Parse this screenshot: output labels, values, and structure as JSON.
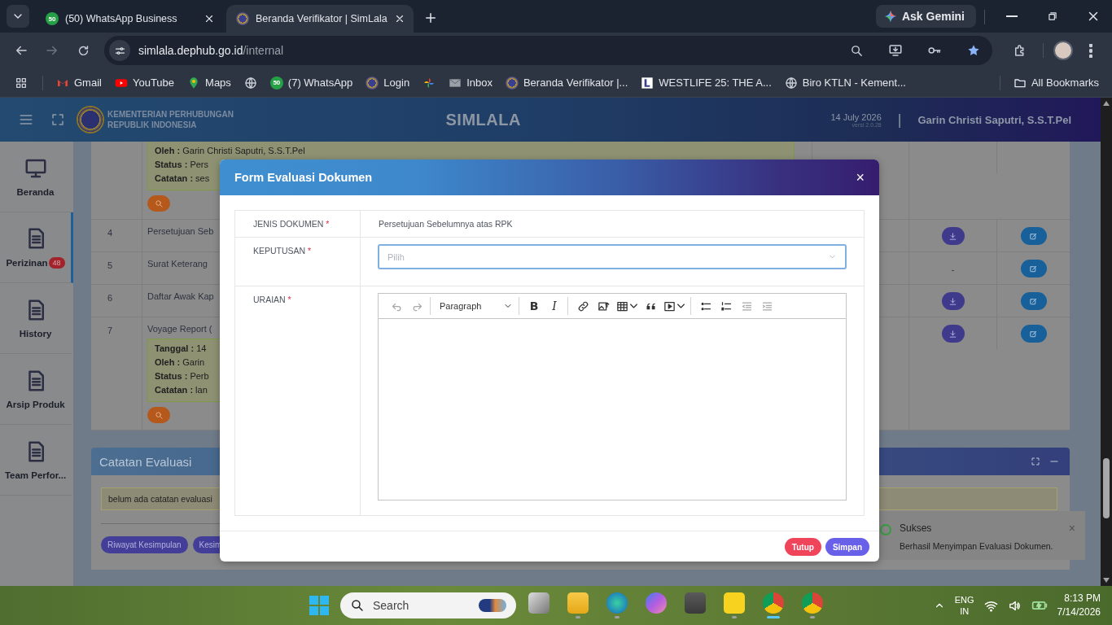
{
  "browser": {
    "tabs": [
      {
        "title": "(50) WhatsApp Business",
        "selected": false,
        "kind": "whatsapp",
        "icon_text": "50"
      },
      {
        "title": "Beranda Verifikator | SimLala",
        "selected": true,
        "kind": "emblem"
      }
    ],
    "ask_gemini": "Ask Gemini",
    "url_host": "simlala.dephub.go.id",
    "url_path": "/internal",
    "bookmarked": true,
    "bookmarks": [
      {
        "kind": "gmail",
        "label": "Gmail"
      },
      {
        "kind": "youtube",
        "label": "YouTube"
      },
      {
        "kind": "maps",
        "label": "Maps"
      },
      {
        "kind": "globe"
      },
      {
        "kind": "whatsapp",
        "icon_text": "50",
        "label": "(7) WhatsApp"
      },
      {
        "kind": "emblem",
        "label": "Login"
      },
      {
        "kind": "pinwheel"
      },
      {
        "kind": "mail",
        "label": "Inbox"
      },
      {
        "kind": "emblem",
        "label": "Beranda Verifikator |..."
      },
      {
        "kind": "letter-tile",
        "label": "WESTLIFE 25: THE A..."
      },
      {
        "kind": "globe",
        "label": "Biro KTLN - Kement..."
      }
    ],
    "all_bookmarks": "All Bookmarks"
  },
  "header": {
    "org_line1": "KEMENTERIAN PERHUBUNGAN",
    "org_line2": "REPUBLIK INDONESIA",
    "app_name": "SIMLALA",
    "date": "14 July 2026",
    "version": "versi 2.0.28",
    "separator": "|",
    "user": "Garin Christi Saputri, S.S.T.Pel"
  },
  "sidebar": {
    "items": [
      {
        "kind": "monitor",
        "label": "Beranda",
        "selected": false
      },
      {
        "kind": "document",
        "label": "Perizinan",
        "badge": "48",
        "selected": true
      },
      {
        "kind": "document",
        "label": "History",
        "selected": false
      },
      {
        "kind": "document",
        "label": "Arsip Produk",
        "selected": false
      },
      {
        "kind": "document",
        "label": "Team Perfor..."
      }
    ]
  },
  "documents": {
    "rows": [
      {
        "note": [
          "**Oleh :** Garin Christi Saputri, S.S.T.Pel",
          "**Status :** Pers",
          "**Catatan :** ses"
        ]
      },
      {
        "no": "4",
        "name": "Persetujuan Seb",
        "download": {
          "kind": "button"
        }
      },
      {
        "no": "5",
        "name": "Surat Keterang",
        "download": {
          "kind": "text",
          "text": "-"
        }
      },
      {
        "no": "6",
        "name": "Daftar Awak Kap",
        "download": {
          "kind": "button"
        }
      },
      {
        "no": "7",
        "name": "Voyage Report (",
        "download": {
          "kind": "button"
        },
        "note": [
          "**Tanggal :** 14",
          "**Oleh :** Garin",
          "**Status :** Perb",
          "**Catatan :** lan"
        ]
      }
    ]
  },
  "evaluation_notes": {
    "title": "Catatan Evaluasi",
    "note": "belum ada catatan evaluasi",
    "buttons": [
      "Riwayat Kesimpulan",
      "Kesim"
    ]
  },
  "toast": {
    "title": "Sukses",
    "message": "Berhasil Menyimpan Evaluasi Dokumen.",
    "close": "×"
  },
  "modal": {
    "title": "Form Evaluasi Dokumen",
    "close": "×",
    "fields": [
      {
        "kind": "static",
        "label": "JENIS DOKUMEN",
        "required_mark": "*",
        "value": "Persetujuan Sebelumnya atas RPK"
      },
      {
        "kind": "select",
        "label": "KEPUTUSAN",
        "required_mark": "*",
        "placeholder": "Pilih",
        "focused": true
      },
      {
        "kind": "editor",
        "label": "URAIAN",
        "required_mark": "*",
        "toolbar": [
          [
            {
              "kind": "undo",
              "disabled": true
            },
            {
              "kind": "redo",
              "disabled": true
            }
          ],
          [
            {
              "kind": "heading",
              "label": "Paragraph",
              "disabled": false
            }
          ],
          [
            {
              "kind": "bold",
              "glyph": "B",
              "disabled": false
            },
            {
              "kind": "italic",
              "glyph": "I",
              "disabled": false
            }
          ],
          [
            {
              "kind": "link",
              "disabled": false
            },
            {
              "kind": "image",
              "disabled": false
            },
            {
              "kind": "table",
              "dropdown": true,
              "disabled": false
            },
            {
              "kind": "quote",
              "disabled": false
            },
            {
              "kind": "media",
              "dropdown": true,
              "disabled": false
            }
          ],
          [
            {
              "kind": "bulleted-list",
              "disabled": false
            },
            {
              "kind": "numbered-list",
              "disabled": false
            },
            {
              "kind": "outdent",
              "disabled": true
            },
            {
              "kind": "indent",
              "disabled": true
            }
          ]
        ]
      }
    ],
    "buttons": [
      {
        "kind": "danger",
        "label": "Tutup"
      },
      {
        "kind": "primary",
        "label": "Simpan"
      }
    ]
  },
  "taskbar": {
    "search_placeholder": "Search",
    "apps": [
      {
        "kind": "task-view",
        "running": false,
        "active": false
      },
      {
        "kind": "folder",
        "running": true,
        "active": false
      },
      {
        "kind": "edge",
        "running": true,
        "active": false
      },
      {
        "kind": "copilot",
        "running": false,
        "active": false
      },
      {
        "kind": "camera",
        "running": false,
        "active": false
      },
      {
        "kind": "sticky-notes",
        "running": true,
        "active": false
      },
      {
        "kind": "chrome",
        "running": true,
        "active": true
      },
      {
        "kind": "chrome",
        "running": true,
        "active": false
      }
    ],
    "lang": "ENG",
    "region": "IN",
    "time": "8:13 PM",
    "date": "7/14/2026"
  }
}
